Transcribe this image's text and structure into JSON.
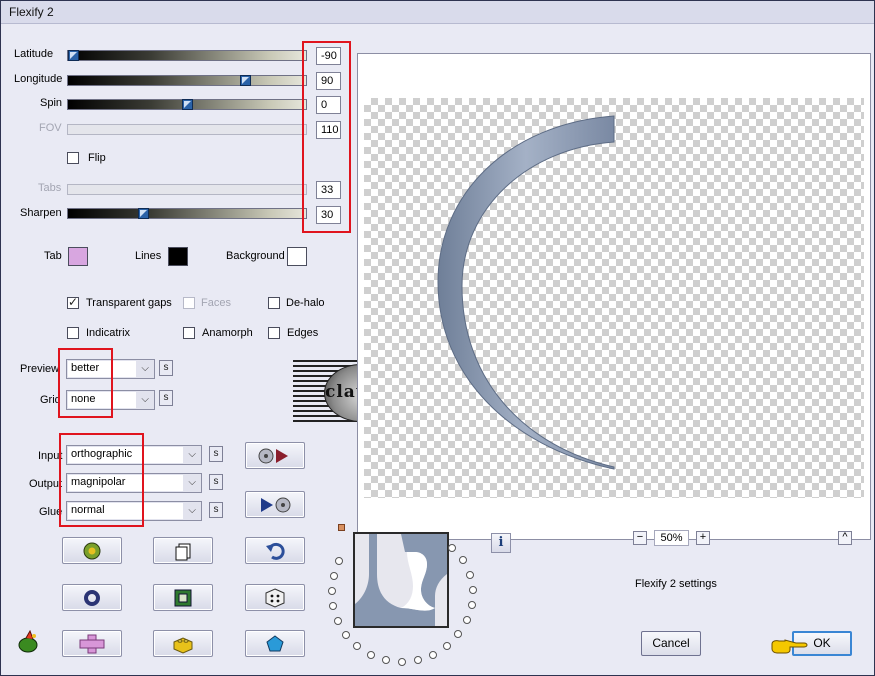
{
  "window": {
    "title": "Flexify 2"
  },
  "sliders": {
    "latitude": {
      "label": "Latitude",
      "value": "-90"
    },
    "longitude": {
      "label": "Longitude",
      "value": "90"
    },
    "spin": {
      "label": "Spin",
      "value": "0"
    },
    "fov": {
      "label": "FOV",
      "value": "110"
    },
    "tabs": {
      "label": "Tabs",
      "value": "33"
    },
    "sharpen": {
      "label": "Sharpen",
      "value": "30"
    }
  },
  "flip": {
    "label": "Flip"
  },
  "colors": {
    "tab": {
      "label": "Tab",
      "color": "#d8a6e0"
    },
    "lines": {
      "label": "Lines",
      "color": "#000000"
    },
    "background": {
      "label": "Background",
      "color": "#ffffff"
    }
  },
  "options": {
    "transparent_gaps": {
      "label": "Transparent gaps"
    },
    "faces": {
      "label": "Faces"
    },
    "de_halo": {
      "label": "De-halo"
    },
    "indicatrix": {
      "label": "Indicatrix"
    },
    "anamorph": {
      "label": "Anamorph"
    },
    "edges": {
      "label": "Edges"
    }
  },
  "selects": {
    "preview": {
      "label": "Preview",
      "value": "better"
    },
    "grid": {
      "label": "Grid",
      "value": "none"
    },
    "input": {
      "label": "Input",
      "value": "orthographic"
    },
    "output": {
      "label": "Output",
      "value": "magnipolar"
    },
    "glue": {
      "label": "Glue",
      "value": "normal"
    }
  },
  "small_button_glyph": "s",
  "watermark": {
    "text": "claudia"
  },
  "zoom": {
    "value": "50%",
    "minus": "−",
    "plus": "+"
  },
  "up_button": "^",
  "info_glyph": "i",
  "settings_name": "Flexify 2 settings",
  "buttons": {
    "cancel": "Cancel",
    "ok": "OK"
  },
  "accent_colors": {
    "highlight": "#e0141e",
    "shape": "#8a98ae"
  }
}
